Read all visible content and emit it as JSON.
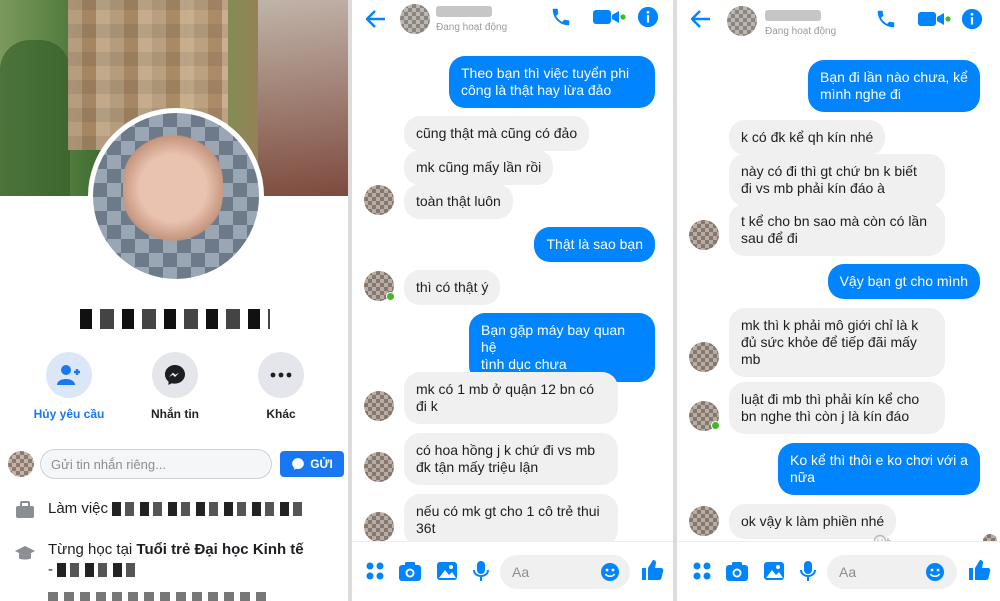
{
  "profile": {
    "name": "",
    "actions": [
      {
        "label": "Hủy yêu cầu",
        "icon": "person-cancel-icon"
      },
      {
        "label": "Nhắn tin",
        "icon": "messenger-icon"
      },
      {
        "label": "Khác",
        "icon": "more-dots-icon"
      }
    ],
    "message_placeholder": "Gửi tin nhắn riêng...",
    "send_label": "GỬI",
    "work_prefix": "Làm việc",
    "study_prefix": "Từng học tại ",
    "study_school": "Tuổi trẻ Đại học Kinh tế",
    "study_cont": "-"
  },
  "colors": {
    "messenger_blue": "#0084ff",
    "facebook_blue": "#1877f2",
    "online_green": "#42b72a"
  },
  "chat1": {
    "status": "Đang hoạt động",
    "composer_placeholder": "Aa",
    "messages": [
      {
        "from": "me",
        "text": "Theo bạn thì việc tuyển phi\ncông là thật hay lừa đảo"
      },
      {
        "from": "them",
        "text": "cũng thật mà cũng có đảo"
      },
      {
        "from": "them",
        "text": "mk cũng mấy lần rồi"
      },
      {
        "from": "them",
        "text": "toàn thật luôn"
      },
      {
        "from": "me",
        "text": "Thật là sao bạn"
      },
      {
        "from": "them",
        "text": "thì có thật ý"
      },
      {
        "from": "me",
        "text": "Bạn gặp máy bay quan hệ\ntình dục chưa"
      },
      {
        "from": "them",
        "text": "mk có 1 mb ở quận 12 bn có\nđi k"
      },
      {
        "from": "them",
        "text": "có hoa hồng j k chứ đi vs mb\nđk tận mấy triệu lận"
      },
      {
        "from": "them",
        "text": "nếu có mk gt cho 1 cô trẻ thui\n36t"
      }
    ]
  },
  "chat2": {
    "status": "Đang hoạt động",
    "composer_placeholder": "Aa",
    "messages": [
      {
        "from": "me",
        "text": "Bạn đi lần nào chưa, kể\nmình nghe đi"
      },
      {
        "from": "them",
        "text": "k có đk kể qh kín nhé"
      },
      {
        "from": "them",
        "text": "này có đi thì gt chứ bn k biết\nđi vs mb phải kín đáo à"
      },
      {
        "from": "them",
        "text": "t kể cho bn sao mà còn có lần\nsau để đi"
      },
      {
        "from": "me",
        "text": "Vậy bạn gt cho mình"
      },
      {
        "from": "them",
        "text": "mk thì k phải mô giới chỉ là k\nđủ sức khỏe để tiếp đãi mấy\nmb"
      },
      {
        "from": "them",
        "text": "luật đi mb thì phải kín kể cho\nbn nghe thì còn j là kín đáo"
      },
      {
        "from": "me",
        "text": "Ko kể thì thôi e ko chơi với a\nnữa"
      },
      {
        "from": "them",
        "text": "ok vậy k làm phiền nhé"
      }
    ]
  }
}
